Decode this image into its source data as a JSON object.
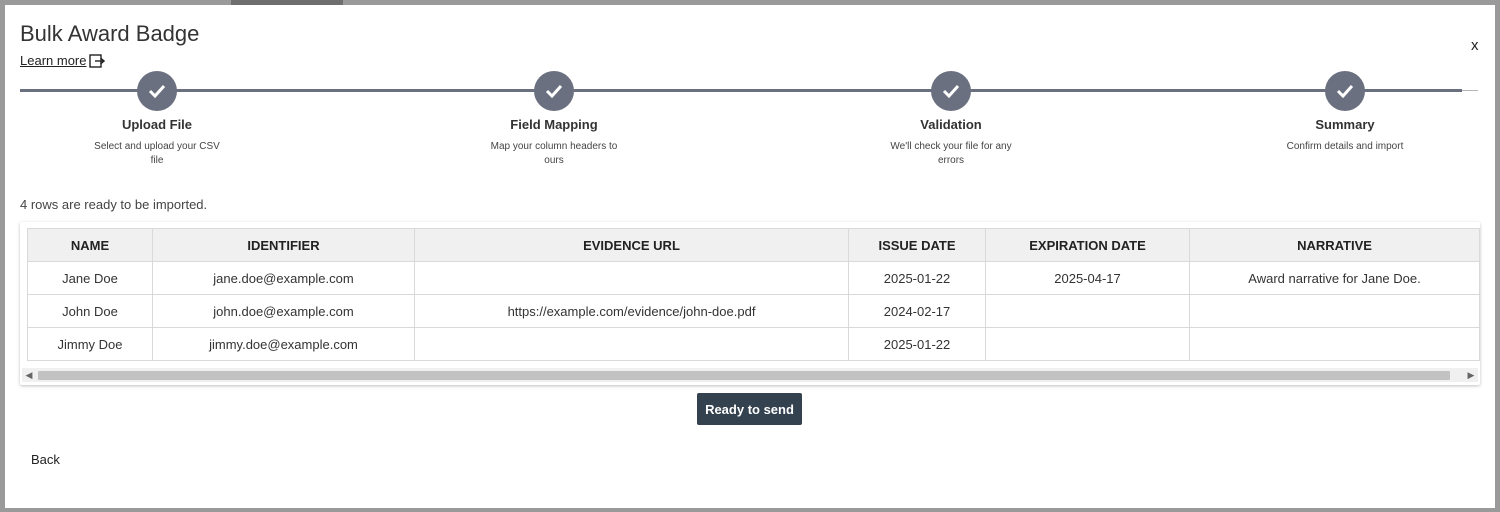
{
  "dialog": {
    "title": "Bulk Award Badge",
    "learn_more": "Learn more",
    "close": "x"
  },
  "steps": [
    {
      "label": "Upload File",
      "desc": "Select and upload your CSV file",
      "status": "complete"
    },
    {
      "label": "Field Mapping",
      "desc": "Map your column headers to ours",
      "status": "complete"
    },
    {
      "label": "Validation",
      "desc": "We'll check your file for any errors",
      "status": "complete"
    },
    {
      "label": "Summary",
      "desc": "Confirm details and import",
      "status": "complete"
    }
  ],
  "status_text": "4 rows are ready to be imported.",
  "table": {
    "headers": [
      "NAME",
      "IDENTIFIER",
      "EVIDENCE URL",
      "ISSUE DATE",
      "EXPIRATION DATE",
      "NARRATIVE"
    ],
    "rows": [
      [
        "Jane Doe",
        "jane.doe@example.com",
        "",
        "2025-01-22",
        "2025-04-17",
        "Award narrative for Jane Doe."
      ],
      [
        "John Doe",
        "john.doe@example.com",
        "https://example.com/evidence/john-doe.pdf",
        "2024-02-17",
        "",
        ""
      ],
      [
        "Jimmy Doe",
        "jimmy.doe@example.com",
        "",
        "2025-01-22",
        "",
        ""
      ]
    ]
  },
  "buttons": {
    "send": "Ready to send",
    "back": "Back"
  },
  "colors": {
    "stepper": "#6b7080",
    "primary_button": "#34424f"
  }
}
